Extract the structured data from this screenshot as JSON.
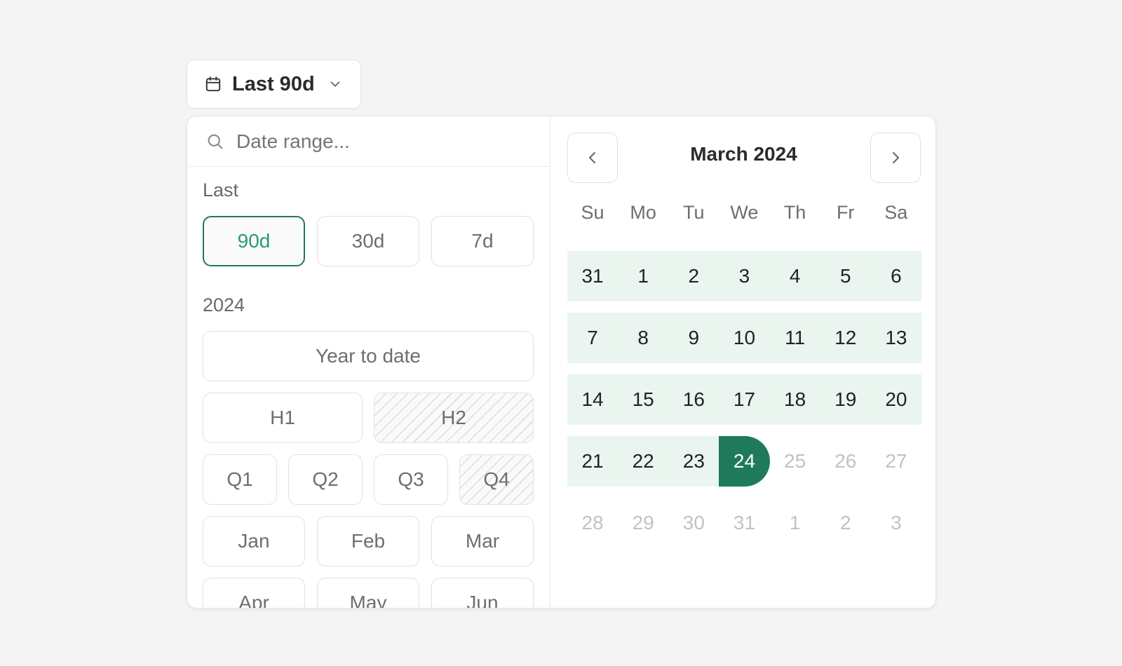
{
  "trigger": {
    "label": "Last 90d",
    "icon": "calendar-icon",
    "chevron": "chevron-down-icon"
  },
  "search": {
    "placeholder": "Date range...",
    "value": ""
  },
  "sections": {
    "last": {
      "label": "Last",
      "options": [
        {
          "label": "90d",
          "state": "selected"
        },
        {
          "label": "30d",
          "state": "default"
        },
        {
          "label": "7d",
          "state": "default"
        }
      ]
    },
    "year": {
      "label": "2024",
      "year_to_date": "Year to date",
      "halves": [
        {
          "label": "H1",
          "state": "default"
        },
        {
          "label": "H2",
          "state": "disabled"
        }
      ],
      "quarters": [
        {
          "label": "Q1",
          "state": "default"
        },
        {
          "label": "Q2",
          "state": "default"
        },
        {
          "label": "Q3",
          "state": "default"
        },
        {
          "label": "Q4",
          "state": "disabled"
        }
      ],
      "months": [
        "Jan",
        "Feb",
        "Mar",
        "Apr",
        "May",
        "Jun"
      ]
    }
  },
  "calendar": {
    "title": "March 2024",
    "prev_icon": "chevron-left-icon",
    "next_icon": "chevron-right-icon",
    "weekdays": [
      "Su",
      "Mo",
      "Tu",
      "We",
      "Th",
      "Fr",
      "Sa"
    ],
    "weeks": [
      [
        "31",
        "1",
        "2",
        "3",
        "4",
        "5",
        "6"
      ],
      [
        "7",
        "8",
        "9",
        "10",
        "11",
        "12",
        "13"
      ],
      [
        "14",
        "15",
        "16",
        "17",
        "18",
        "19",
        "20"
      ],
      [
        "21",
        "22",
        "23",
        "24",
        "25",
        "26",
        "27"
      ],
      [
        "28",
        "29",
        "30",
        "31",
        "1",
        "2",
        "3"
      ]
    ],
    "selected_day": "24",
    "colors": {
      "accent": "#1f7a5c",
      "range_bg": "#ebf5f0",
      "muted": "#c2c2c2"
    }
  }
}
